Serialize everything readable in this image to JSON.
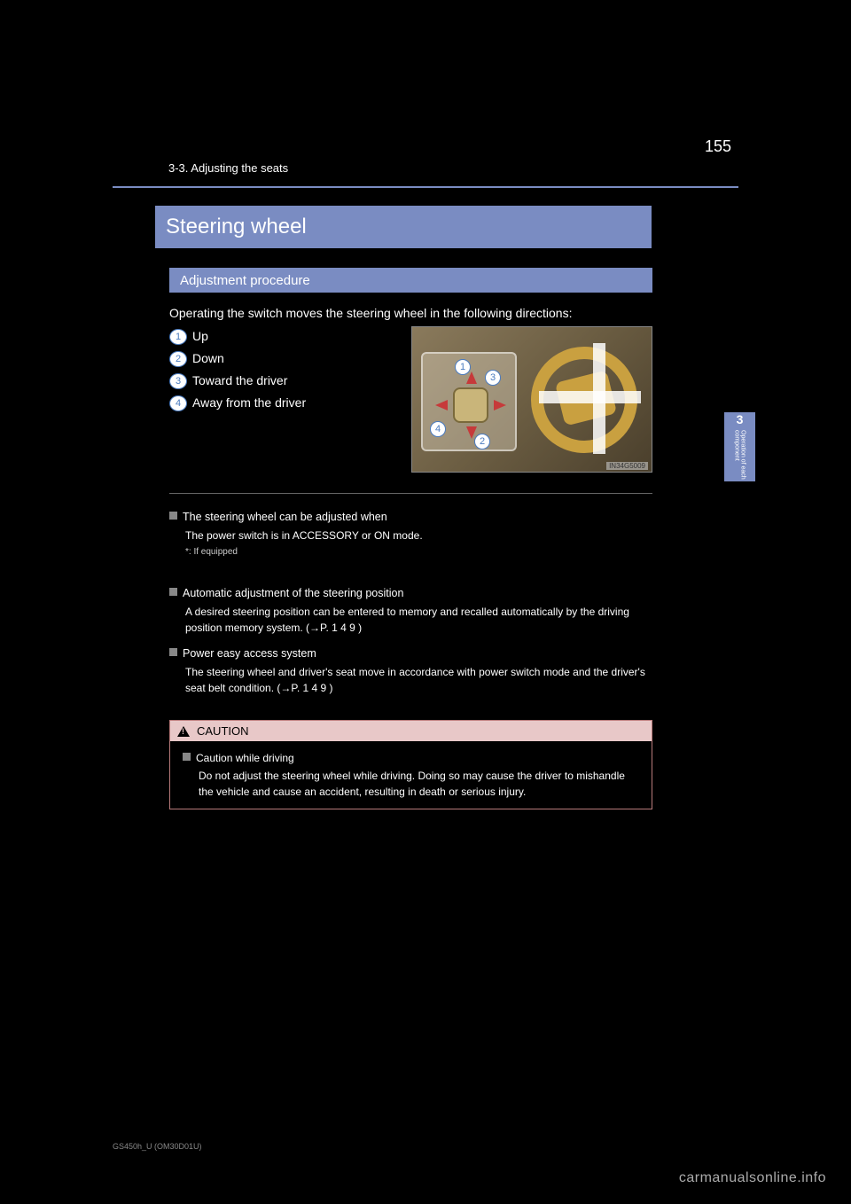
{
  "page_number": "155",
  "chapter_ref": "3-3. Adjusting the seats",
  "side_tab": {
    "num": "3",
    "label": "Operation of each component"
  },
  "title": "Steering wheel",
  "subheading": "Adjustment procedure",
  "intro": "Operating the switch moves the steering wheel in the following directions:",
  "steps": [
    {
      "n": "1",
      "text": "Up"
    },
    {
      "n": "2",
      "text": "Down"
    },
    {
      "n": "3",
      "text": "Toward the driver"
    },
    {
      "n": "4",
      "text": "Away from the driver"
    }
  ],
  "diagram_id": "IN34G5009",
  "notes": [
    {
      "title": "The steering wheel can be adjusted when",
      "body": "The power switch is in ACCESSORY or ON mode."
    },
    {
      "title": "Automatic adjustment of the steering position",
      "body": "A desired steering position can be entered to memory and recalled automatically by the driving position memory system. (→P. 1 4 9 )"
    },
    {
      "title": "Power easy access system",
      "body": "The steering wheel and driver's seat move in accordance with power switch mode and the driver's seat belt condition. (→P. 1 4 9 )"
    }
  ],
  "caution": {
    "label": "CAUTION",
    "title": "Caution while driving",
    "text": "Do not adjust the steering wheel while driving. Doing so may cause the driver to mishandle the vehicle and cause an accident, resulting in death or serious injury."
  },
  "footer_code": "GS450h_U (OM30D01U)",
  "watermark": "carmanualsonline.info"
}
